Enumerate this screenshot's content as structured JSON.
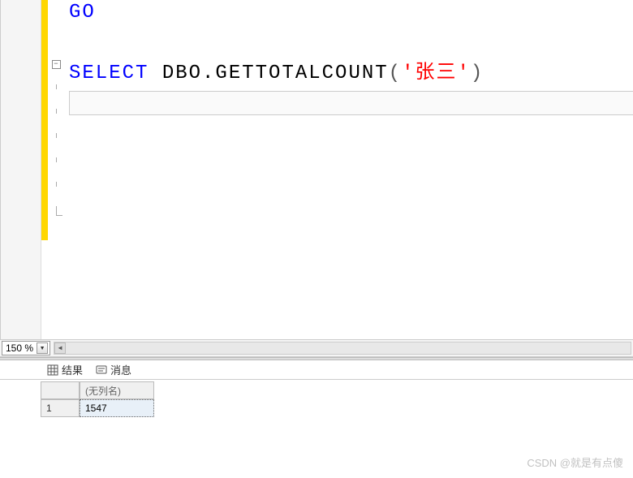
{
  "editor": {
    "lines": {
      "go": "GO",
      "select_kw": "SELECT",
      "func_call": " DBO.GETTOTALCOUNT",
      "paren_open": "(",
      "arg_string": "'张三'",
      "paren_close": ")"
    },
    "outline_collapse_glyph": "−"
  },
  "zoom": {
    "value": "150 %",
    "dropdown_glyph": "▼"
  },
  "scrollbar": {
    "left_arrow": "◀",
    "right_arrow": "▶"
  },
  "tabs": {
    "results": "结果",
    "messages": "消息"
  },
  "grid": {
    "header": {
      "col1": "(无列名)"
    },
    "rows": [
      {
        "num": "1",
        "col1": "1547"
      }
    ]
  },
  "watermark": "CSDN @就是有点傻"
}
